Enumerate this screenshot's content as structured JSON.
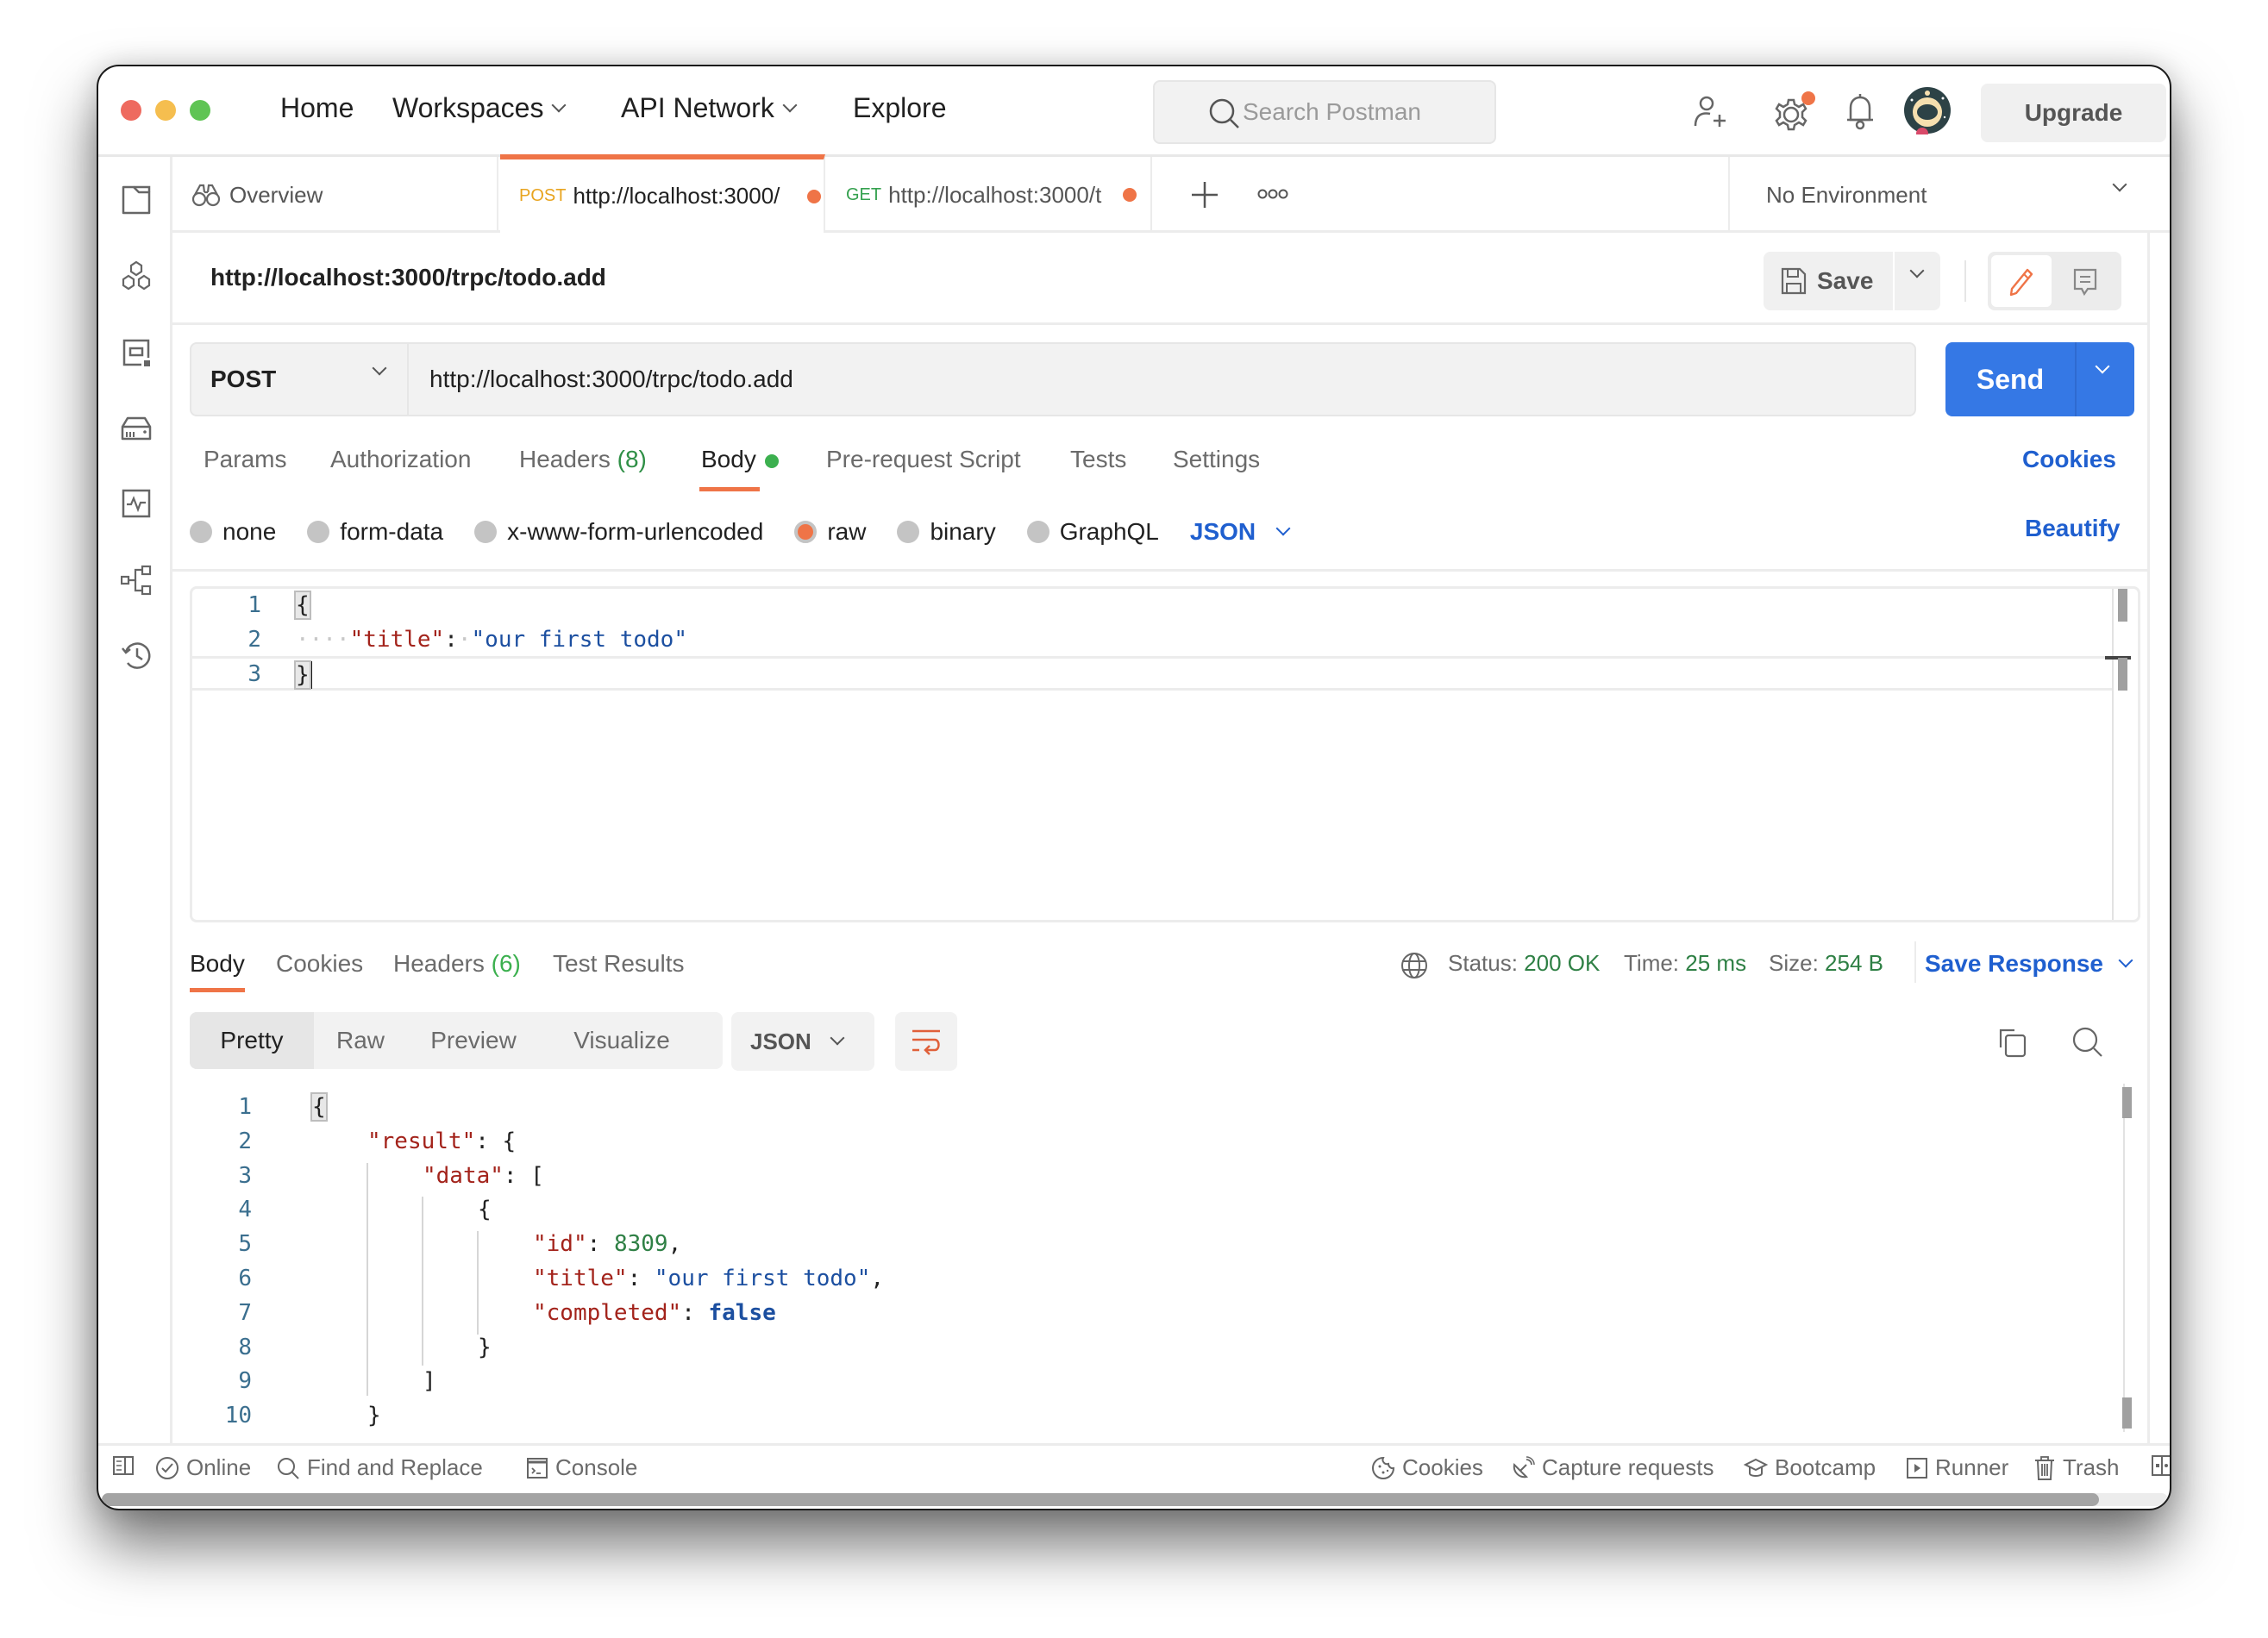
{
  "window": {
    "traffic_lights": [
      {
        "name": "close",
        "color": "#ee6a5f"
      },
      {
        "name": "minimize",
        "color": "#f5be4f"
      },
      {
        "name": "maximize",
        "color": "#5fc454"
      }
    ]
  },
  "topnav": {
    "home": "Home",
    "workspaces": "Workspaces",
    "api_network": "API Network",
    "explore": "Explore",
    "search_placeholder": "Search Postman",
    "upgrade": "Upgrade"
  },
  "sidebar": {
    "items": [
      {
        "icon": "collections-icon"
      },
      {
        "icon": "apis-icon"
      },
      {
        "icon": "environments-icon"
      },
      {
        "icon": "mock-servers-icon"
      },
      {
        "icon": "monitors-icon"
      },
      {
        "icon": "flows-icon"
      },
      {
        "icon": "history-icon"
      }
    ]
  },
  "tabs": {
    "overview": "Overview",
    "items": [
      {
        "method": "POST",
        "label": "http://localhost:3000/",
        "unsaved": true,
        "active": true
      },
      {
        "method": "GET",
        "label": "http://localhost:3000/t",
        "unsaved": true,
        "active": false
      }
    ],
    "environment": "No Environment"
  },
  "request": {
    "title": "http://localhost:3000/trpc/todo.add",
    "save_label": "Save",
    "method": "POST",
    "url": "http://localhost:3000/trpc/todo.add",
    "send_label": "Send",
    "tabs": {
      "params": "Params",
      "authorization": "Authorization",
      "headers": "Headers",
      "headers_count": "(8)",
      "body": "Body",
      "prerequest": "Pre-request Script",
      "tests": "Tests",
      "settings": "Settings"
    },
    "cookies_link": "Cookies",
    "body_types": [
      "none",
      "form-data",
      "x-www-form-urlencoded",
      "raw",
      "binary",
      "GraphQL"
    ],
    "selected_body_type": "raw",
    "body_language": "JSON",
    "beautify_link": "Beautify",
    "body_lines": [
      "1",
      "2",
      "3"
    ],
    "body_code": {
      "open": "{",
      "indent": "····",
      "key": "\"title\"",
      "colon": ":",
      "space": "·",
      "value": "\"our first todo\"",
      "close": "}"
    }
  },
  "response": {
    "tabs": {
      "body": "Body",
      "cookies": "Cookies",
      "headers": "Headers",
      "headers_count": "(6)",
      "test_results": "Test Results"
    },
    "status_label": "Status:",
    "status_value": "200 OK",
    "time_label": "Time:",
    "time_value": "25 ms",
    "size_label": "Size:",
    "size_value": "254 B",
    "save_response": "Save Response",
    "views": [
      "Pretty",
      "Raw",
      "Preview",
      "Visualize"
    ],
    "active_view": "Pretty",
    "format": "JSON",
    "line_numbers": [
      "1",
      "2",
      "3",
      "4",
      "5",
      "6",
      "7",
      "8",
      "9",
      "10"
    ],
    "code": {
      "l1": "{",
      "l2_key": "\"result\"",
      "l2_rest": ": {",
      "l3_key": "\"data\"",
      "l3_rest": ": [",
      "l4": "{",
      "l5_key": "\"id\"",
      "l5_colon": ": ",
      "l5_val": "8309",
      "l5_comma": ",",
      "l6_key": "\"title\"",
      "l6_colon": ": ",
      "l6_val": "\"our first todo\"",
      "l6_comma": ",",
      "l7_key": "\"completed\"",
      "l7_colon": ": ",
      "l7_val": "false",
      "l8": "}",
      "l9": "]",
      "l10": "}"
    }
  },
  "statusbar": {
    "online": "Online",
    "find_replace": "Find and Replace",
    "console": "Console",
    "cookies": "Cookies",
    "capture": "Capture requests",
    "bootcamp": "Bootcamp",
    "runner": "Runner",
    "trash": "Trash"
  },
  "colors": {
    "accent_orange": "#ef7447",
    "send_blue": "#3578e5",
    "link_blue": "#1f5fcf",
    "success_green": "#2f8045"
  }
}
